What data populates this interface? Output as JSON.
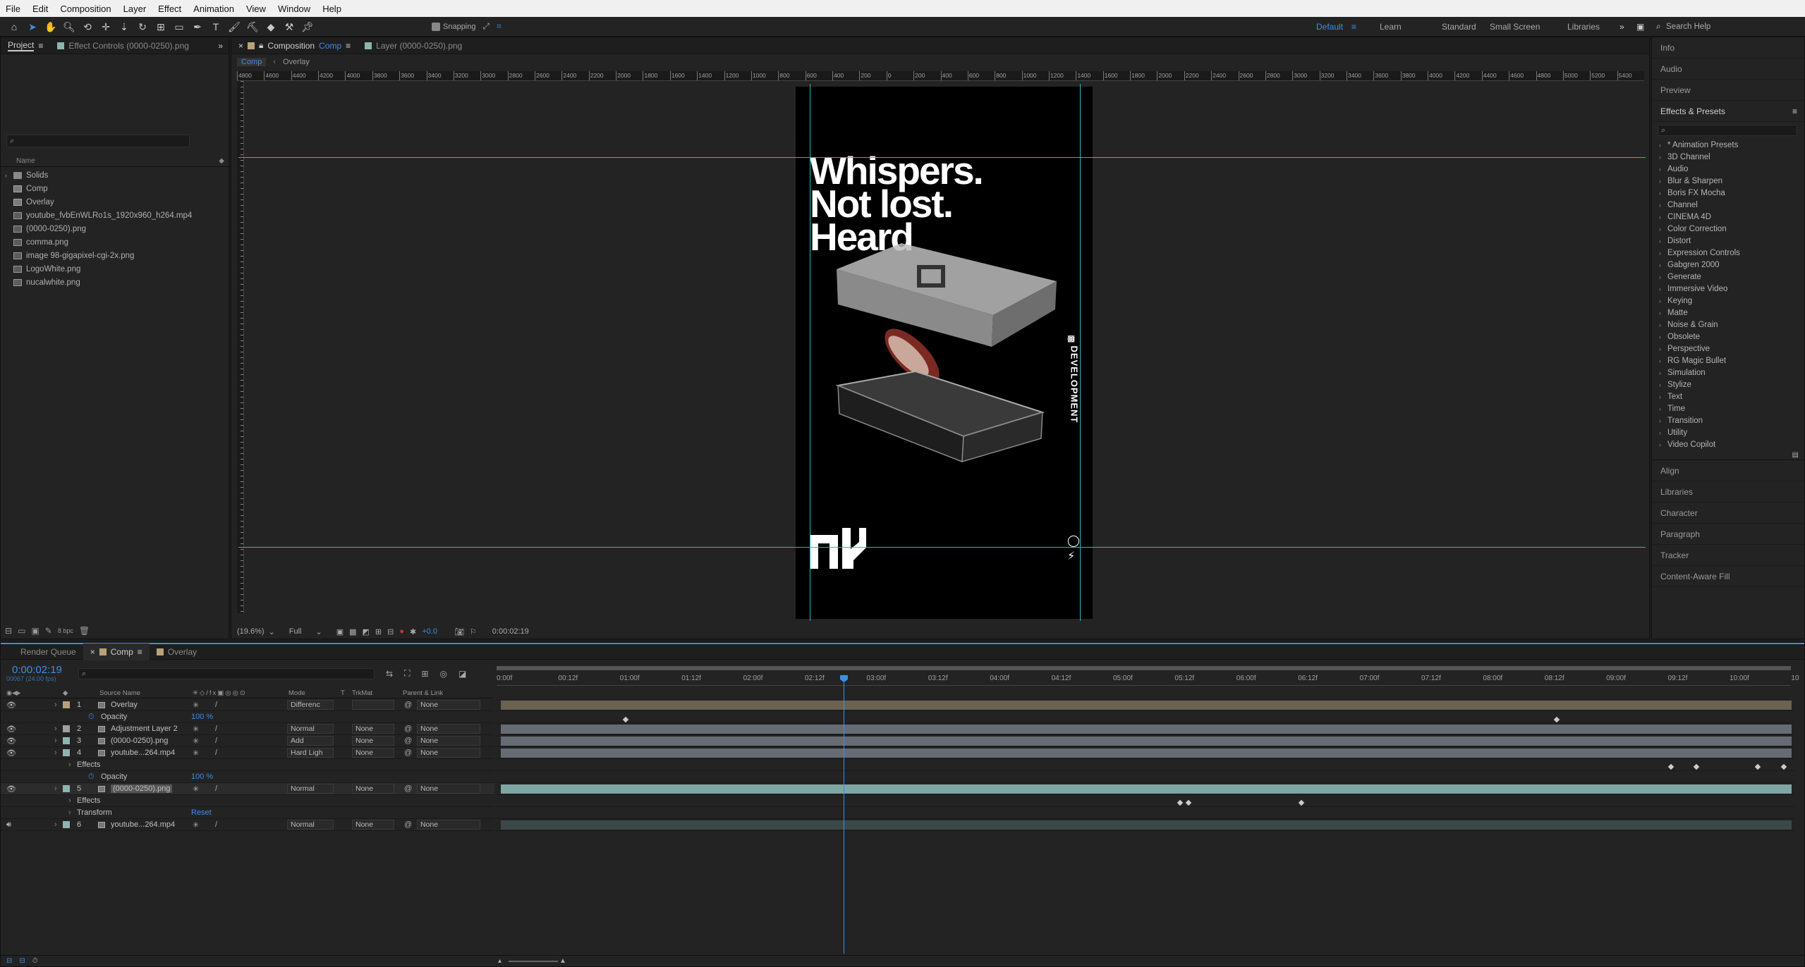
{
  "menu": [
    "File",
    "Edit",
    "Composition",
    "Layer",
    "Effect",
    "Animation",
    "View",
    "Window",
    "Help"
  ],
  "toolbar": {
    "snapping_label": "Snapping",
    "workspaces": [
      "Default",
      "Learn",
      "Standard",
      "Small Screen",
      "Libraries"
    ],
    "active_workspace": "Default",
    "search_help_placeholder": "Search Help"
  },
  "project_panel": {
    "tab_label": "Project",
    "effect_controls_tab": "Effect Controls (0000-0250).png",
    "column_name": "Name",
    "items": [
      {
        "name": "Solids",
        "type": "folder"
      },
      {
        "name": "Comp",
        "type": "comp"
      },
      {
        "name": "Overlay",
        "type": "comp"
      },
      {
        "name": "youtube_fvbEnWLRo1s_1920x960_h264.mp4",
        "type": "video"
      },
      {
        "name": "(0000-0250).png",
        "type": "sequence"
      },
      {
        "name": "comma.png",
        "type": "image"
      },
      {
        "name": "image 98-gigapixel-cgi-2x.png",
        "type": "image"
      },
      {
        "name": "LogoWhite.png",
        "type": "image"
      },
      {
        "name": "nucalwhite.png",
        "type": "image"
      }
    ],
    "bpc": "8 bpc"
  },
  "composition_panel": {
    "tab_prefix": "Composition",
    "tab_comp": "Comp",
    "layer_tab": "Layer (0000-0250).png",
    "breadcrumbs": [
      "Comp",
      "Overlay"
    ],
    "ruler_labels": [
      "4800",
      "4600",
      "4400",
      "4200",
      "4000",
      "3800",
      "3600",
      "3400",
      "3200",
      "3000",
      "2800",
      "2600",
      "2400",
      "2200",
      "2000",
      "1800",
      "1600",
      "1400",
      "1200",
      "1000",
      "800",
      "600",
      "400",
      "200",
      "0",
      "200",
      "400",
      "600",
      "800",
      "1000",
      "1200",
      "1400",
      "1600",
      "1800",
      "2000",
      "2200",
      "2400",
      "2600",
      "2800",
      "3000",
      "3200",
      "3400",
      "3600",
      "3800",
      "4000",
      "4200",
      "4400",
      "4600",
      "4800",
      "5000",
      "5200",
      "5400"
    ],
    "zoom": "(19.6%)",
    "resolution": "Full",
    "exposure": "+0.0",
    "timecode": "0:00:02:19",
    "art": {
      "headline": [
        "Whispers.",
        "Not lost.",
        "Heard"
      ],
      "side_text": "DEVELOPMENT"
    }
  },
  "right_panels": {
    "top": [
      "Info",
      "Audio",
      "Preview"
    ],
    "effects_presets_title": "Effects & Presets",
    "effects": [
      "* Animation Presets",
      "3D Channel",
      "Audio",
      "Blur & Sharpen",
      "Boris FX Mocha",
      "Channel",
      "CINEMA 4D",
      "Color Correction",
      "Distort",
      "Expression Controls",
      "Gabgren 2000",
      "Generate",
      "Immersive Video",
      "Keying",
      "Matte",
      "Noise & Grain",
      "Obsolete",
      "Perspective",
      "RG Magic Bullet",
      "Simulation",
      "Stylize",
      "Text",
      "Time",
      "Transition",
      "Utility",
      "Video Copilot"
    ],
    "bottom": [
      "Align",
      "Libraries",
      "Character",
      "Paragraph",
      "Tracker",
      "Content-Aware Fill"
    ]
  },
  "timeline": {
    "tabs": [
      {
        "label": "Render Queue",
        "color": "",
        "active": false
      },
      {
        "label": "Comp",
        "color": "#b8a27a",
        "active": true
      },
      {
        "label": "Overlay",
        "color": "#b8a27a",
        "active": false
      }
    ],
    "timecode": "0:00:02:19",
    "frame_info": "00067 (24.00 fps)",
    "columns": {
      "source": "Source Name",
      "mode": "Mode",
      "t": "T",
      "trkmat": "TrkMat",
      "parent": "Parent & Link"
    },
    "layers": [
      {
        "num": "1",
        "name": "Overlay",
        "mode": "Differenc",
        "trkmat": "",
        "parent": "None",
        "color": "#b8a27a",
        "eye": true
      },
      {
        "num": "",
        "name": "Opacity",
        "value": "100 %",
        "is_prop": true
      },
      {
        "num": "2",
        "name": "Adjustment Layer 2",
        "mode": "Normal",
        "trkmat": "None",
        "parent": "None",
        "color": "#a0a0a0",
        "eye": true
      },
      {
        "num": "3",
        "name": "(0000-0250).png",
        "mode": "Add",
        "trkmat": "None",
        "parent": "None",
        "color": "#8fb5b0",
        "eye": true
      },
      {
        "num": "4",
        "name": "youtube...264.mp4",
        "mode": "Hard Ligh",
        "trkmat": "None",
        "parent": "None",
        "color": "#8fb5b0",
        "eye": true
      },
      {
        "num": "",
        "name": "Effects",
        "is_group": true
      },
      {
        "num": "",
        "name": "Opacity",
        "value": "100 %",
        "is_prop": true
      },
      {
        "num": "5",
        "name": "(0000-0250).png",
        "mode": "Normal",
        "trkmat": "None",
        "parent": "None",
        "color": "#8fb5b0",
        "eye": true,
        "selected": true
      },
      {
        "num": "",
        "name": "Effects",
        "is_group": true
      },
      {
        "num": "",
        "name": "Transform",
        "value": "Reset",
        "is_group": true
      },
      {
        "num": "6",
        "name": "youtube...264.mp4",
        "mode": "Normal",
        "trkmat": "None",
        "parent": "None",
        "color": "#8fb5b0",
        "eye": false
      }
    ],
    "ruler": [
      "0:00f",
      "00:12f",
      "01:00f",
      "01:12f",
      "02:00f",
      "02:12f",
      "03:00f",
      "03:12f",
      "04:00f",
      "04:12f",
      "05:00f",
      "05:12f",
      "06:00f",
      "06:12f",
      "07:00f",
      "07:12f",
      "08:00f",
      "08:12f",
      "09:00f",
      "09:12f",
      "10:00f",
      "10"
    ]
  },
  "colors": {
    "accent": "#3d8ee6",
    "guide": "#2bb5c8",
    "label_sand": "#b8a27a",
    "label_teal": "#8fb5b0"
  }
}
